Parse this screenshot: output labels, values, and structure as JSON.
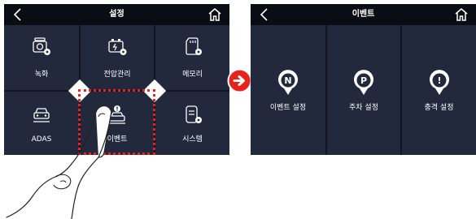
{
  "left_screen": {
    "title": "설정",
    "tiles": [
      {
        "label": "녹화",
        "icon": "camera-gear-icon"
      },
      {
        "label": "전압관리",
        "icon": "battery-gear-icon"
      },
      {
        "label": "메모리",
        "icon": "memory-card-gear-icon"
      },
      {
        "label": "ADAS",
        "icon": "car-front-icon"
      },
      {
        "label": "이벤트",
        "icon": "car-alert-icon"
      },
      {
        "label": "시스템",
        "icon": "device-gear-icon"
      }
    ]
  },
  "right_screen": {
    "title": "이벤트",
    "tiles": [
      {
        "label": "이벤트 설정",
        "badge": "N",
        "icon": "pin-n-icon"
      },
      {
        "label": "주차 설정",
        "badge": "P",
        "icon": "pin-p-icon"
      },
      {
        "label": "충격 설정",
        "badge": "!",
        "icon": "pin-alert-icon"
      }
    ]
  },
  "colors": {
    "screen_bg": "#23293d",
    "topbar_bg": "#0b0d14",
    "accent_red": "#e8231b"
  },
  "icons": {
    "back": "chevron-left-icon",
    "home": "home-icon",
    "transition": "arrow-right-circle-icon",
    "gesture": "pointing-hand"
  }
}
